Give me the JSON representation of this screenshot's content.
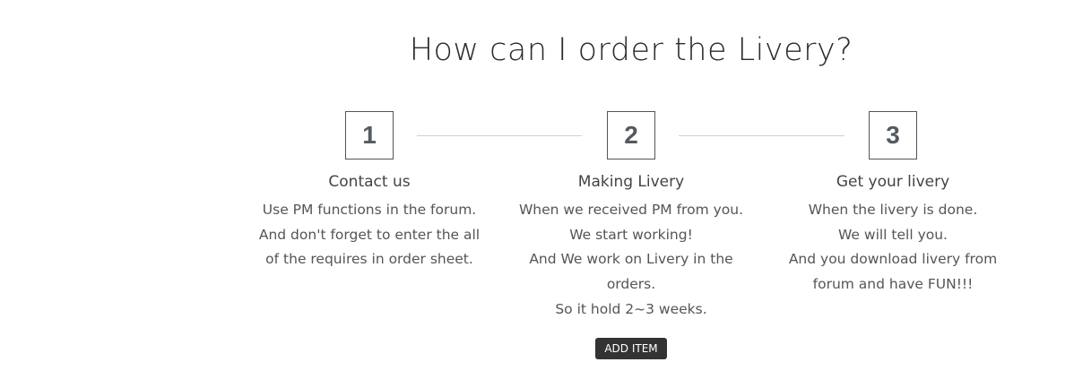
{
  "title": "How can I order the Livery?",
  "steps": [
    {
      "number": "1",
      "title": "Contact us",
      "lines": [
        "Use PM functions in the forum.",
        "And don't forget to enter the all",
        "of the requires in order sheet."
      ]
    },
    {
      "number": "2",
      "title": "Making Livery",
      "lines": [
        "When we received PM from you.",
        "We start working!",
        "And We work on Livery in the",
        "orders.",
        "So it hold 2~3 weeks."
      ]
    },
    {
      "number": "3",
      "title": "Get your livery",
      "lines": [
        "When the livery is done.",
        "We will tell you.",
        "And you download livery from",
        "forum and have FUN!!!"
      ]
    }
  ],
  "add_item_label": "ADD ITEM"
}
